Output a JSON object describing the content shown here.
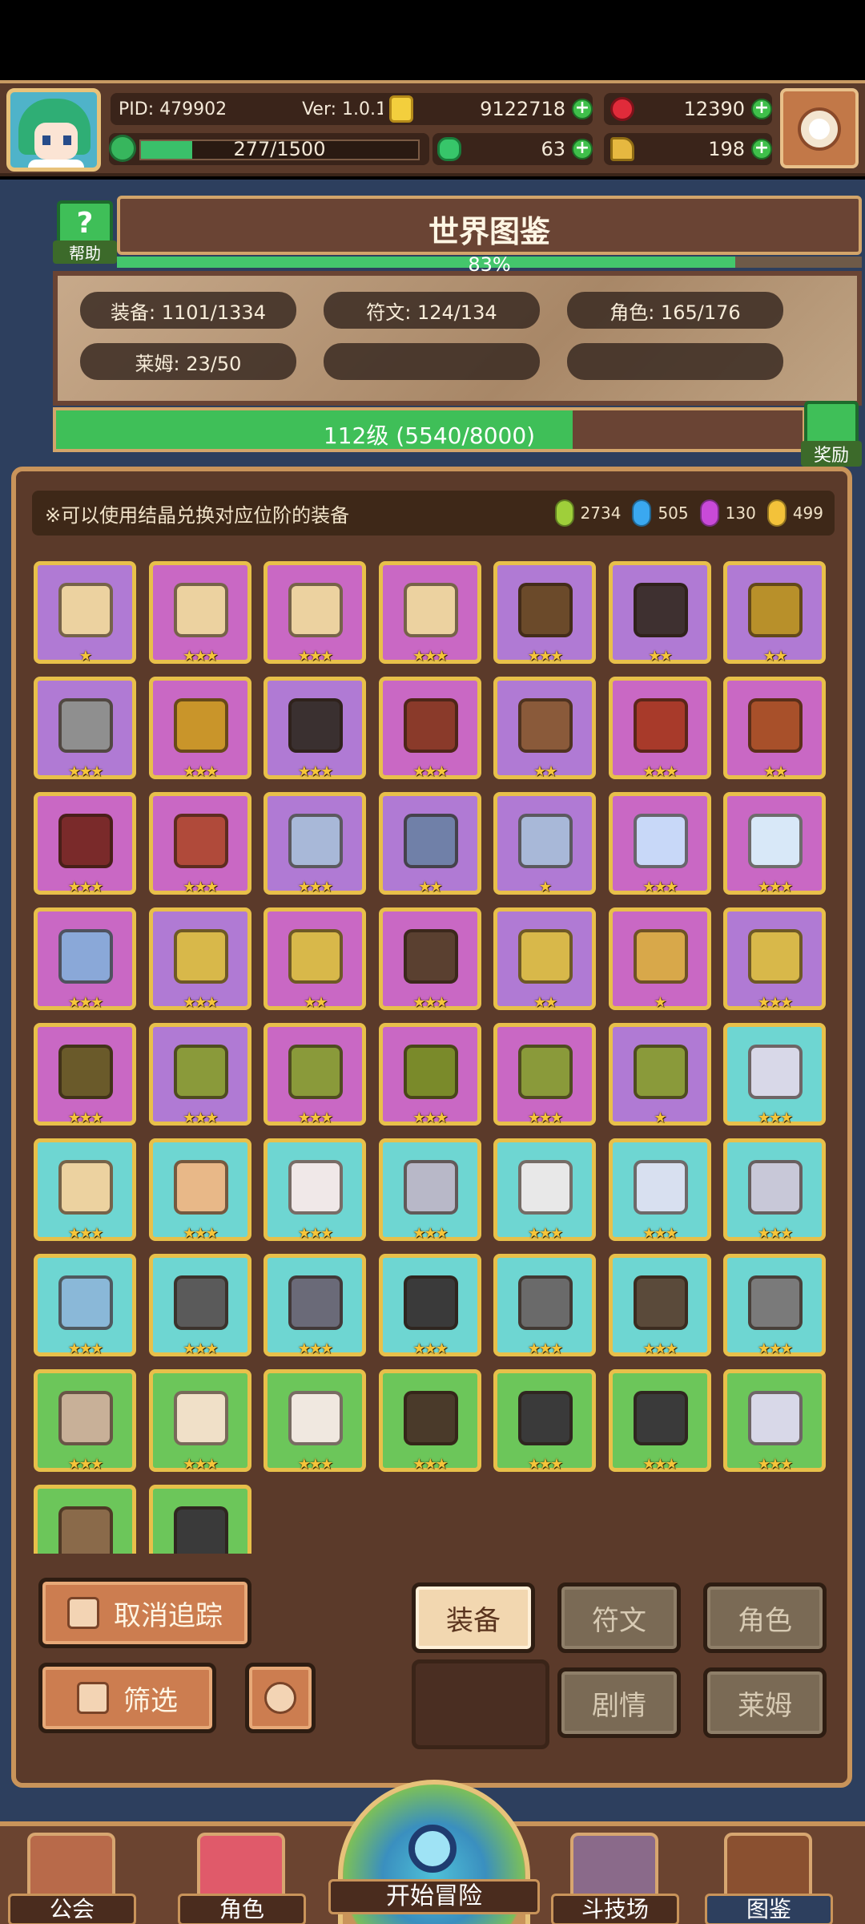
{
  "header": {
    "pid": "PID: 479902",
    "version": "Ver: 1.0.1.2",
    "coins": "9122718",
    "gems": "12390",
    "xp_text": "277/1500",
    "xp_fraction": 0.185,
    "clovers": "63",
    "boots": "198"
  },
  "world_book": {
    "title": "世界图鉴",
    "help_label": "帮助",
    "percent": "83%",
    "percent_fraction": 0.83,
    "stats": {
      "equipment": "装备: 1101/1334",
      "runes": "符文: 124/134",
      "characters": "角色: 165/176",
      "slime": "莱姆: 23/50"
    },
    "level_text": "112级 (5540/8000)",
    "level_fraction": 0.6925,
    "reward_label": "奖励"
  },
  "notice": {
    "hint": "※可以使用结晶兑换对应位阶的装备",
    "crystals": [
      {
        "color": "#9fcf3a",
        "value": "2734"
      },
      {
        "color": "#3aa8f0",
        "value": "505"
      },
      {
        "color": "#c84ad8",
        "value": "130"
      },
      {
        "color": "#f3c23a",
        "value": "499"
      }
    ]
  },
  "equipment_rows": [
    [
      {
        "bg": "purple",
        "icon": "ingot-icon",
        "color": "#ecd2a0",
        "stars": "★"
      },
      {
        "bg": "pink",
        "icon": "gloves-icon",
        "color": "#ecd2a0",
        "stars": "★★★"
      },
      {
        "bg": "pink",
        "icon": "ring-icon",
        "color": "#ecd2a0",
        "stars": "★★★"
      },
      {
        "bg": "pink",
        "icon": "boots-icon",
        "color": "#ecd2a0",
        "stars": "★★★"
      },
      {
        "bg": "purple",
        "icon": "helmet-icon",
        "color": "#6b4a2a",
        "stars": "★★★"
      },
      {
        "bg": "purple",
        "icon": "armor-icon",
        "color": "#3e3030",
        "stars": "★★"
      },
      {
        "bg": "purple",
        "icon": "boots-icon",
        "color": "#b8902a",
        "stars": "★★"
      }
    ],
    [
      {
        "bg": "purple",
        "icon": "sword-icon",
        "color": "#8f8f8f",
        "stars": "★★★"
      },
      {
        "bg": "pink",
        "icon": "shield-icon",
        "color": "#c9952a",
        "stars": "★★★"
      },
      {
        "bg": "purple",
        "icon": "ring-icon",
        "color": "#3a3030",
        "stars": "★★★"
      },
      {
        "bg": "pink",
        "icon": "bow-icon",
        "color": "#8a3a2a",
        "stars": "★★★"
      },
      {
        "bg": "purple",
        "icon": "arrow-icon",
        "color": "#8a5a3a",
        "stars": "★★"
      },
      {
        "bg": "pink",
        "icon": "bracer-icon",
        "color": "#a83a2a",
        "stars": "★★★"
      },
      {
        "bg": "pink",
        "icon": "necklace-icon",
        "color": "#a8502a",
        "stars": "★★"
      }
    ],
    [
      {
        "bg": "pink",
        "icon": "necklace-icon",
        "color": "#7a2a2a",
        "stars": "★★★"
      },
      {
        "bg": "pink",
        "icon": "ring-icon",
        "color": "#b04a3a",
        "stars": "★★★"
      },
      {
        "bg": "purple",
        "icon": "armor-icon",
        "color": "#a8b8d8",
        "stars": "★★★"
      },
      {
        "bg": "purple",
        "icon": "helmet-icon",
        "color": "#7080a8",
        "stars": "★★"
      },
      {
        "bg": "purple",
        "icon": "gauntlet-icon",
        "color": "#a8b8d8",
        "stars": "★"
      },
      {
        "bg": "pink",
        "icon": "crystal-icon",
        "color": "#c8d8f8",
        "stars": "★★★"
      },
      {
        "bg": "pink",
        "icon": "necklace-icon",
        "color": "#d8e8f8",
        "stars": "★★★"
      }
    ],
    [
      {
        "bg": "pink",
        "icon": "ring-icon",
        "color": "#8aa8d8",
        "stars": "★★★"
      },
      {
        "bg": "purple",
        "icon": "scepter-icon",
        "color": "#d8b84a",
        "stars": "★★★"
      },
      {
        "bg": "pink",
        "icon": "circlet-icon",
        "color": "#d8b84a",
        "stars": "★★"
      },
      {
        "bg": "pink",
        "icon": "armor-icon",
        "color": "#5a4030",
        "stars": "★★★"
      },
      {
        "bg": "purple",
        "icon": "crown-icon",
        "color": "#d8b84a",
        "stars": "★★"
      },
      {
        "bg": "pink",
        "icon": "necklace-icon",
        "color": "#d8a84a",
        "stars": "★"
      },
      {
        "bg": "purple",
        "icon": "ring-icon",
        "color": "#d8b84a",
        "stars": "★★★"
      }
    ],
    [
      {
        "bg": "pink",
        "icon": "necklace-icon",
        "color": "#6a5a2a",
        "stars": "★★★"
      },
      {
        "bg": "purple",
        "icon": "amulet-icon",
        "color": "#8a9a3a",
        "stars": "★★★"
      },
      {
        "bg": "pink",
        "icon": "ring-icon",
        "color": "#8a9a3a",
        "stars": "★★★"
      },
      {
        "bg": "pink",
        "icon": "armor-icon",
        "color": "#7a8a2a",
        "stars": "★★★"
      },
      {
        "bg": "pink",
        "icon": "gauntlet-icon",
        "color": "#8a9a3a",
        "stars": "★★★"
      },
      {
        "bg": "purple",
        "icon": "boots-icon",
        "color": "#8a9a3a",
        "stars": "★"
      },
      {
        "bg": "cyan",
        "icon": "dagger-icon",
        "color": "#d8d8e8",
        "stars": "★★★"
      }
    ],
    [
      {
        "bg": "cyan",
        "icon": "helmet-icon",
        "color": "#ecd2a0",
        "stars": "★★★"
      },
      {
        "bg": "cyan",
        "icon": "armor-icon",
        "color": "#e8b888",
        "stars": "★★★"
      },
      {
        "bg": "cyan",
        "icon": "hat-icon",
        "color": "#f0e8e8",
        "stars": "★★★"
      },
      {
        "bg": "cyan",
        "icon": "ring-icon",
        "color": "#b8b8c8",
        "stars": "★★★"
      },
      {
        "bg": "cyan",
        "icon": "boots-icon",
        "color": "#e8e8e8",
        "stars": "★★★"
      },
      {
        "bg": "cyan",
        "icon": "necklace-icon",
        "color": "#d8e0f0",
        "stars": "★★★"
      },
      {
        "bg": "cyan",
        "icon": "orb-icon",
        "color": "#c8c8d8",
        "stars": "★★★"
      }
    ],
    [
      {
        "bg": "cyan",
        "icon": "ring-icon",
        "color": "#8ab8d8",
        "stars": "★★★"
      },
      {
        "bg": "cyan",
        "icon": "sword-icon",
        "color": "#5a5a5a",
        "stars": "★★★"
      },
      {
        "bg": "cyan",
        "icon": "boots-icon",
        "color": "#6a6a78",
        "stars": "★★★"
      },
      {
        "bg": "cyan",
        "icon": "ring-icon",
        "color": "#3a3a3a",
        "stars": "★★★"
      },
      {
        "bg": "cyan",
        "icon": "shield-icon",
        "color": "#6a6a6a",
        "stars": "★★★"
      },
      {
        "bg": "cyan",
        "icon": "helmet-icon",
        "color": "#5a4a3a",
        "stars": "★★★"
      },
      {
        "bg": "cyan",
        "icon": "armor-icon",
        "color": "#7a7a7a",
        "stars": "★★★"
      }
    ],
    [
      {
        "bg": "green",
        "icon": "helmet-icon",
        "color": "#c8b098",
        "stars": "★★★"
      },
      {
        "bg": "green",
        "icon": "bone-icon",
        "color": "#f0e0c8",
        "stars": "★★★"
      },
      {
        "bg": "green",
        "icon": "boots-icon",
        "color": "#f0e8e0",
        "stars": "★★★"
      },
      {
        "bg": "green",
        "icon": "hammer-icon",
        "color": "#4a3a2a",
        "stars": "★★★"
      },
      {
        "bg": "green",
        "icon": "ring-icon",
        "color": "#3a3a3a",
        "stars": "★★★"
      },
      {
        "bg": "green",
        "icon": "necklace-icon",
        "color": "#3a3a3a",
        "stars": "★★★"
      },
      {
        "bg": "green",
        "icon": "dagger-icon",
        "color": "#d8d8e8",
        "stars": "★★★"
      }
    ],
    [
      {
        "bg": "green",
        "icon": "helmet-icon",
        "color": "#8a6a4a",
        "stars": ""
      },
      {
        "bg": "green",
        "icon": "ring-icon",
        "color": "#3a3a3a",
        "stars": ""
      }
    ]
  ],
  "controls": {
    "untrack": "取消追踪",
    "filter": "筛选",
    "tab_equipment": "装备",
    "tab_runes": "符文",
    "tab_characters": "角色",
    "tab_story": "剧情",
    "tab_slime": "莱姆"
  },
  "nav": {
    "guild": "公会",
    "characters": "角色",
    "adventure": "开始冒险",
    "arena": "斗技场",
    "codex": "图鉴"
  }
}
